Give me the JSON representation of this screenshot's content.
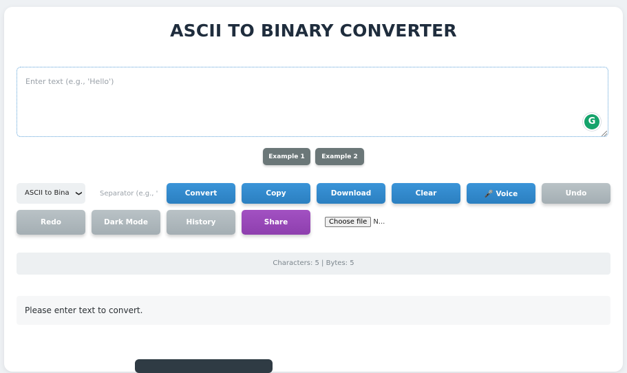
{
  "header": {
    "title": "ASCII TO BINARY CONVERTER"
  },
  "input": {
    "placeholder": "Enter text (e.g., 'Hello')",
    "value": ""
  },
  "grammarly": {
    "icon": "grammarly-icon",
    "glyph": "G",
    "color": "#15a36b"
  },
  "examples": [
    {
      "label": "Example 1"
    },
    {
      "label": "Example 2"
    }
  ],
  "controls": {
    "mode": {
      "selected": "ASCII to Bina",
      "chevron": "❯"
    },
    "separator": {
      "placeholder": "Separator (e.g., '",
      "value": ""
    }
  },
  "buttons": {
    "convert": "Convert",
    "copy": "Copy",
    "download": "Download",
    "clear": "Clear",
    "voice": "🎤 Voice",
    "undo": "Undo",
    "redo": "Redo",
    "dark_mode": "Dark Mode",
    "history": "History",
    "share": "Share"
  },
  "file": {
    "button": "Choose file",
    "status": "N..."
  },
  "stats": {
    "text": "Characters: 5 | Bytes: 5"
  },
  "output": {
    "message": "Please enter text to convert."
  },
  "colors": {
    "primary": "#2b7fc0",
    "secondary": "#a4aeb3",
    "accent": "#8e3fae",
    "example": "#6b7778"
  }
}
